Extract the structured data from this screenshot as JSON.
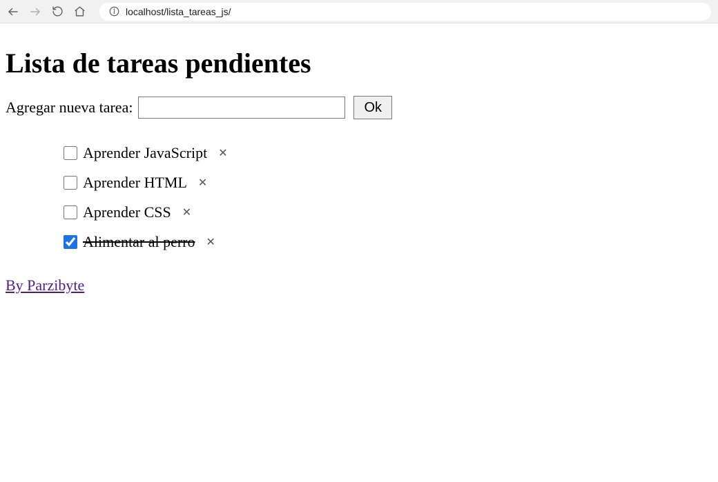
{
  "browser": {
    "url": "localhost/lista_tareas_js/"
  },
  "page": {
    "title": "Lista de tareas pendientes",
    "add_label": "Agregar nueva tarea:",
    "ok_button": "Ok",
    "footer_link": "By Parzibyte"
  },
  "tasks": [
    {
      "label": "Aprender JavaScript",
      "done": false
    },
    {
      "label": "Aprender HTML",
      "done": false
    },
    {
      "label": "Aprender CSS",
      "done": false
    },
    {
      "label": "Alimentar al perro",
      "done": true
    }
  ]
}
